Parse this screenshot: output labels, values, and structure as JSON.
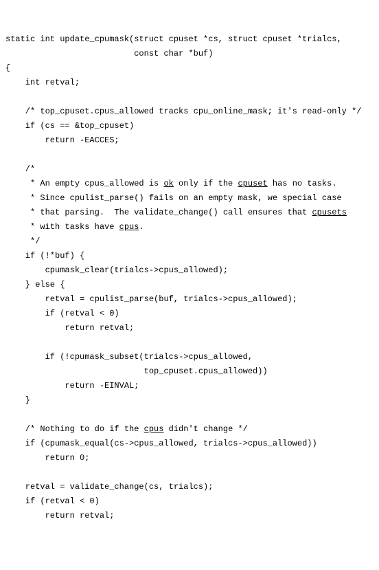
{
  "code": {
    "l01a": "static int update_cpumask(struct cpuset *cs, struct cpuset *trialcs,",
    "l02a": "                          const char *buf)",
    "l03a": "{",
    "l04a": "    int retval;",
    "l05a": "",
    "l06a": "    /* top_cpuset.cpus_allowed tracks cpu_online_mask; it's read-only */",
    "l07a": "    if (cs == &top_cpuset)",
    "l08a": "        return -EACCES;",
    "l09a": "",
    "l10a": "    /*",
    "l11a": "     * An empty cpus_allowed is ",
    "l11b": "ok",
    "l11c": " only if the ",
    "l11d": "cpuset",
    "l11e": " has no tasks.",
    "l12a": "     * Since cpulist_parse() fails on an empty mask, we special case",
    "l13a": "     * that parsing.  The validate_change() call ensures that ",
    "l13b": "cpusets",
    "l14a": "     * with tasks have ",
    "l14b": "cpus",
    "l14c": ".",
    "l15a": "     */",
    "l16a": "    if (!*buf) {",
    "l17a": "        cpumask_clear(trialcs->cpus_allowed);",
    "l18a": "    } else {",
    "l19a": "        retval = cpulist_parse(buf, trialcs->cpus_allowed);",
    "l20a": "        if (retval < 0)",
    "l21a": "            return retval;",
    "l22a": "",
    "l23a": "        if (!cpumask_subset(trialcs->cpus_allowed,",
    "l24a": "                            top_cpuset.cpus_allowed))",
    "l25a": "            return -EINVAL;",
    "l26a": "    }",
    "l27a": "",
    "l28a": "    /* Nothing to do if the ",
    "l28b": "cpus",
    "l28c": " didn't change */",
    "l29a": "    if (cpumask_equal(cs->cpus_allowed, trialcs->cpus_allowed))",
    "l30a": "        return 0;",
    "l31a": "",
    "l32a": "    retval = validate_change(cs, trialcs);",
    "l33a": "    if (retval < 0)",
    "l34a": "        return retval;"
  }
}
